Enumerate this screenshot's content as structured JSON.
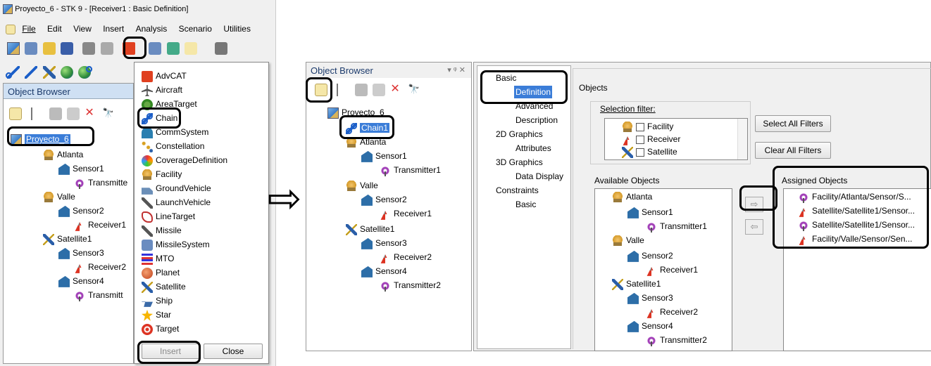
{
  "app": {
    "title": "Proyecto_6 - STK 9 - [Receiver1 : Basic Definition]"
  },
  "menu": [
    "File",
    "Edit",
    "View",
    "Insert",
    "Analysis",
    "Scenario",
    "Utilities"
  ],
  "left_panel": {
    "title": "Object Browser",
    "tree": {
      "root": "Proyecto_6",
      "atlanta": "Atlanta",
      "sensor1": "Sensor1",
      "transmitter1": "Transmitte",
      "valle": "Valle",
      "sensor2": "Sensor2",
      "receiver1": "Receiver1",
      "satellite1": "Satellite1",
      "sensor3": "Sensor3",
      "receiver2": "Receiver2",
      "sensor4": "Sensor4",
      "transmitter2": "Transmitt"
    }
  },
  "insert_menu": {
    "items": [
      "AdvCAT",
      "Aircraft",
      "AreaTarget",
      "Chain",
      "CommSystem",
      "Constellation",
      "CoverageDefinition",
      "Facility",
      "GroundVehicle",
      "LaunchVehicle",
      "LineTarget",
      "Missile",
      "MissileSystem",
      "MTO",
      "Planet",
      "Satellite",
      "Ship",
      "Star",
      "Target"
    ],
    "insert_label": "Insert",
    "close_label": "Close"
  },
  "mid_panel": {
    "title": "Object Browser",
    "pin": "▾ ᵠ ✕",
    "tree": {
      "root": "Proyecto_6",
      "chain": "Chain1",
      "atlanta": "Atlanta",
      "sensor1": "Sensor1",
      "transmitter1": "Transmitter1",
      "valle": "Valle",
      "sensor2": "Sensor2",
      "receiver1": "Receiver1",
      "satellite1": "Satellite1",
      "sensor3": "Sensor3",
      "receiver2": "Receiver2",
      "sensor4": "Sensor4",
      "transmitter2": "Transmitter2"
    }
  },
  "properties": {
    "nav": {
      "basic": "Basic",
      "definition": "Definition",
      "advanced": "Advanced",
      "description": "Description",
      "g2d": "2D Graphics",
      "attributes": "Attributes",
      "g3d": "3D Graphics",
      "data_display": "Data Display",
      "constraints": "Constraints",
      "constraints_basic": "Basic"
    },
    "objects_label": "Objects",
    "selection_filter_label": "Selection filter:",
    "filters": [
      "Facility",
      "Receiver",
      "Satellite"
    ],
    "select_all": "Select All Filters",
    "clear_all": "Clear All Filters",
    "available_label": "Available Objects",
    "available": {
      "atlanta": "Atlanta",
      "sensor1": "Sensor1",
      "transmitter1": "Transmitter1",
      "valle": "Valle",
      "sensor2": "Sensor2",
      "receiver1": "Receiver1",
      "satellite1": "Satellite1",
      "sensor3": "Sensor3",
      "receiver2": "Receiver2",
      "sensor4": "Sensor4",
      "transmitter2": "Transmitter2"
    },
    "assigned_label": "Assigned Objects",
    "assigned": [
      "Facility/Atlanta/Sensor/S...",
      "Satellite/Satellite1/Sensor...",
      "Satellite/Satellite1/Sensor...",
      "Facility/Valle/Sensor/Sen..."
    ],
    "add_arrow": "⇨",
    "remove_arrow": "⇦"
  },
  "big_arrow": "⇨"
}
